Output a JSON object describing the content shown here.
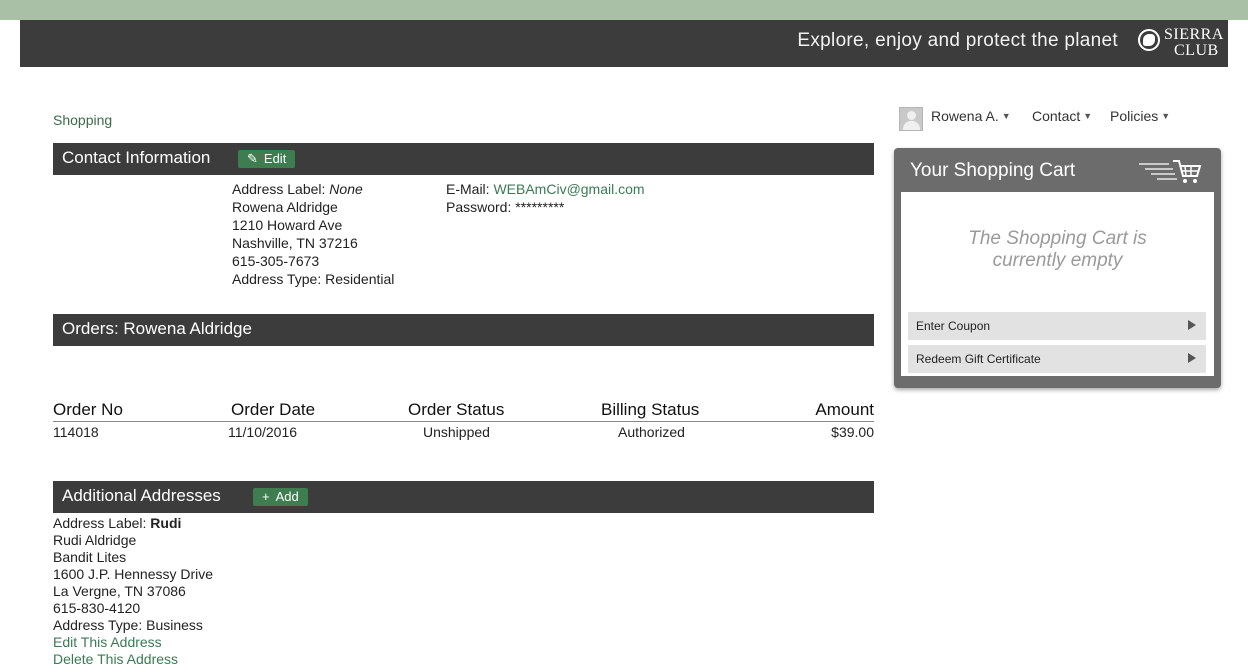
{
  "header": {
    "tagline": "Explore, enjoy and protect the planet",
    "logo_line1": "SIERRA",
    "logo_line2": "CLUB"
  },
  "breadcrumb": "Shopping",
  "topnav": {
    "user": "Rowena A.",
    "contact": "Contact",
    "policies": "Policies"
  },
  "contact_info": {
    "title": "Contact Information",
    "edit_label": "Edit",
    "address_label_prefix": "Address Label:",
    "address_label_value": "None",
    "name": "Rowena Aldridge",
    "street": "1210 Howard Ave",
    "city_state_zip": "Nashville, TN 37216",
    "phone": "615-305-7673",
    "address_type": "Address Type: Residential",
    "email_prefix": "E-Mail:",
    "email": "WEBAmCiv@gmail.com",
    "password": "Password: *********"
  },
  "orders": {
    "title": "Orders: Rowena Aldridge",
    "columns": [
      "Order No",
      "Order Date",
      "Order Status",
      "Billing Status",
      "Amount"
    ],
    "rows": [
      {
        "order_no": "114018",
        "order_date": "11/10/2016",
        "order_status": "Unshipped",
        "billing_status": "Authorized",
        "amount": "$39.00"
      }
    ]
  },
  "additional_addresses": {
    "title": "Additional Addresses",
    "add_label": "Add",
    "items": [
      {
        "label_prefix": "Address Label:",
        "label": "Rudi",
        "name": "Rudi Aldridge",
        "company": "Bandit Lites",
        "street": "1600 J.P. Hennessy Drive",
        "city_state_zip": "La Vergne, TN 37086",
        "phone": "615-830-4120",
        "address_type": "Address Type: Business",
        "edit_link": "Edit This Address",
        "delete_link": "Delete This Address"
      }
    ]
  },
  "cart": {
    "title": "Your Shopping Cart",
    "empty_line1": "The Shopping Cart is",
    "empty_line2": "currently empty",
    "coupon_label": "Enter Coupon",
    "gift_label": "Redeem Gift Certificate"
  },
  "colors": {
    "header_bg": "#3c3c3c",
    "accent_green": "#3d7d4f",
    "link_green": "#3b7a55",
    "cart_bg": "#6c6c6c"
  }
}
